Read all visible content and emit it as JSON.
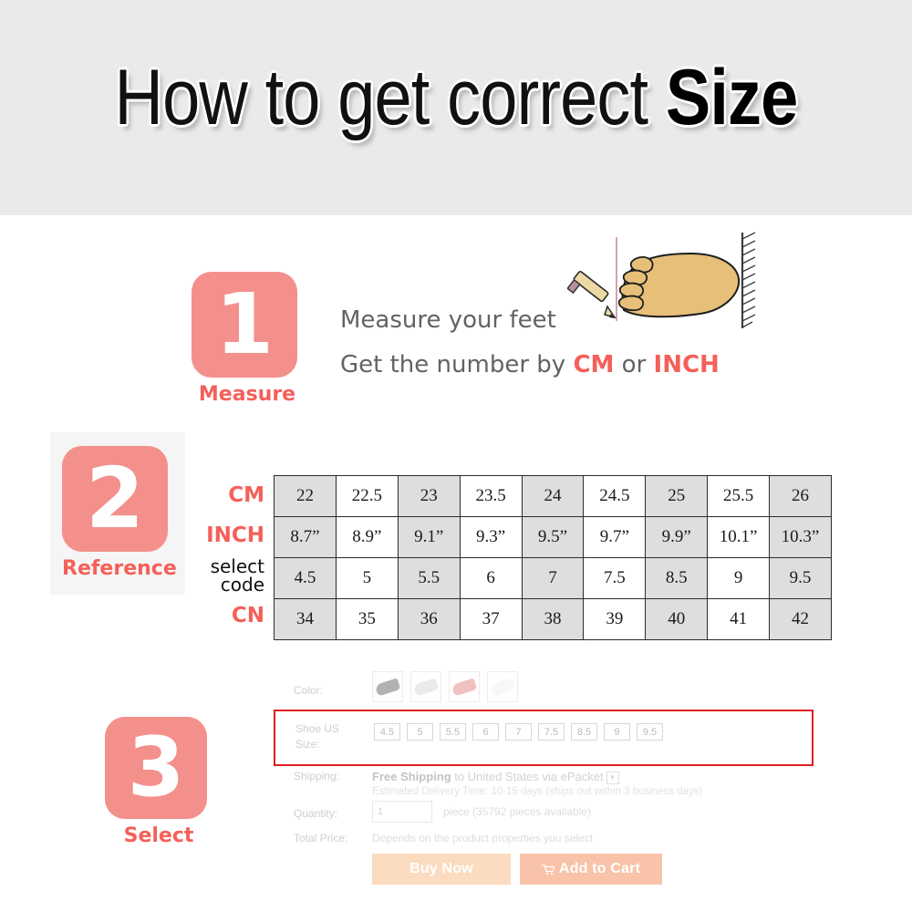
{
  "header": {
    "title_prefix": "How to get correct ",
    "title_strong": "Size",
    "band_color": "#eaeaea"
  },
  "theme": {
    "badge_bg": "#f4908c",
    "accent_text": "#f4605a",
    "table_shade": "#dedede",
    "highlight_border": "#e02020",
    "buy_now_bg": "#fbdcc0",
    "add_cart_bg": "#f9c3a9"
  },
  "steps": [
    {
      "number": "1",
      "caption": "Measure",
      "line1": "Measure your feet",
      "line2_prefix": "Get the number by ",
      "line2_accent1": "CM",
      "line2_mid": " or ",
      "line2_accent2": "INCH"
    },
    {
      "number": "2",
      "caption": "Reference"
    },
    {
      "number": "3",
      "caption": "Select"
    }
  ],
  "illustration": {
    "name": "foot-measuring-illustration",
    "foot_color": "#e8c07a",
    "pencil_color": "#e8c98f",
    "wall_color": "#4a4a4a",
    "line_color": "#c98b9a"
  },
  "size_table": {
    "row_labels": [
      "CM",
      "INCH",
      "select code",
      "CN"
    ],
    "rows": [
      {
        "label": "CM",
        "values": [
          "22",
          "22.5",
          "23",
          "23.5",
          "24",
          "24.5",
          "25",
          "25.5",
          "26"
        ]
      },
      {
        "label": "INCH",
        "values": [
          "8.7”",
          "8.9”",
          "9.1”",
          "9.3”",
          "9.5”",
          "9.7”",
          "9.9”",
          "10.1”",
          "10.3”"
        ]
      },
      {
        "label": "select code",
        "values": [
          "4.5",
          "5",
          "5.5",
          "6",
          "7",
          "7.5",
          "8.5",
          "9",
          "9.5"
        ]
      },
      {
        "label": "CN",
        "values": [
          "34",
          "35",
          "36",
          "37",
          "38",
          "39",
          "40",
          "41",
          "42"
        ]
      }
    ]
  },
  "product_form": {
    "color": {
      "label": "Color:",
      "swatches": [
        "#6f7276",
        "#d9d9d9",
        "#e58e8e",
        "#f0f0f0"
      ]
    },
    "shoe_size": {
      "label_line1": "Shoe US",
      "label_line2": "Size:",
      "options": [
        "4.5",
        "5",
        "5.5",
        "6",
        "7",
        "7.5",
        "8.5",
        "9",
        "9.5"
      ]
    },
    "shipping": {
      "label": "Shipping:",
      "free_text": "Free Shipping",
      "dest_text": " to United States via ePacket",
      "caret": "▼",
      "estimate": "Estimated Delivery Time: 10-15 days (ships out within 3 business days)"
    },
    "quantity": {
      "label": "Quantity:",
      "value": "1",
      "note": "piece (35792 pieces available)"
    },
    "total_price": {
      "label": "Total Price:",
      "value": "Depends on the product properties you select"
    },
    "buttons": {
      "buy_now": "Buy Now",
      "add_to_cart": "Add to Cart",
      "cart_icon": "Ὥ2"
    }
  }
}
